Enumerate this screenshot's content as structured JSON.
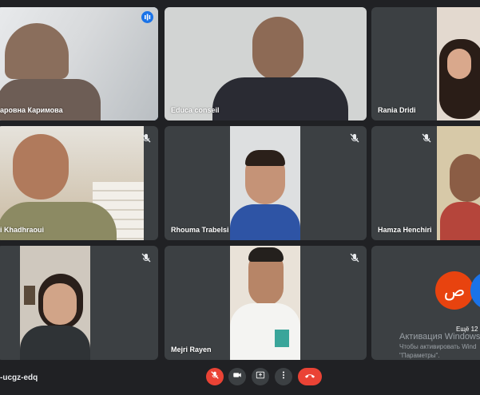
{
  "meeting": {
    "code": "-ucgz-edq",
    "more_count": "Ещё 12 ч"
  },
  "participants": [
    {
      "name": "аровна Каримова",
      "muted": false,
      "speaking": true
    },
    {
      "name": "Educa conseil",
      "muted": false
    },
    {
      "name": "Rania Dridi",
      "muted": false
    },
    {
      "name": "i Khadhraoui",
      "muted": true
    },
    {
      "name": "Rhouma Trabelsi",
      "muted": true
    },
    {
      "name": "Hamza Henchiri",
      "muted": true
    },
    {
      "name": "",
      "muted": true
    },
    {
      "name": "Mejri Rayen",
      "muted": true
    },
    {
      "name": "",
      "muted": false
    }
  ],
  "overflow_badge": {
    "glyph": "ص",
    "color": "#e8430f"
  },
  "activation": {
    "title": "Активация Windows",
    "line1": "Чтобы активировать Wind",
    "line2": "\"Параметры\"."
  },
  "controls": [
    {
      "name": "mic-toggle",
      "icon": "mic-off-icon",
      "color": "#ea4335"
    },
    {
      "name": "camera-toggle",
      "icon": "camera-icon"
    },
    {
      "name": "present-screen",
      "icon": "present-icon"
    },
    {
      "name": "more-options",
      "icon": "more-vert-icon"
    },
    {
      "name": "leave-call",
      "icon": "phone-hangup-icon",
      "color": "#ea4335"
    }
  ]
}
